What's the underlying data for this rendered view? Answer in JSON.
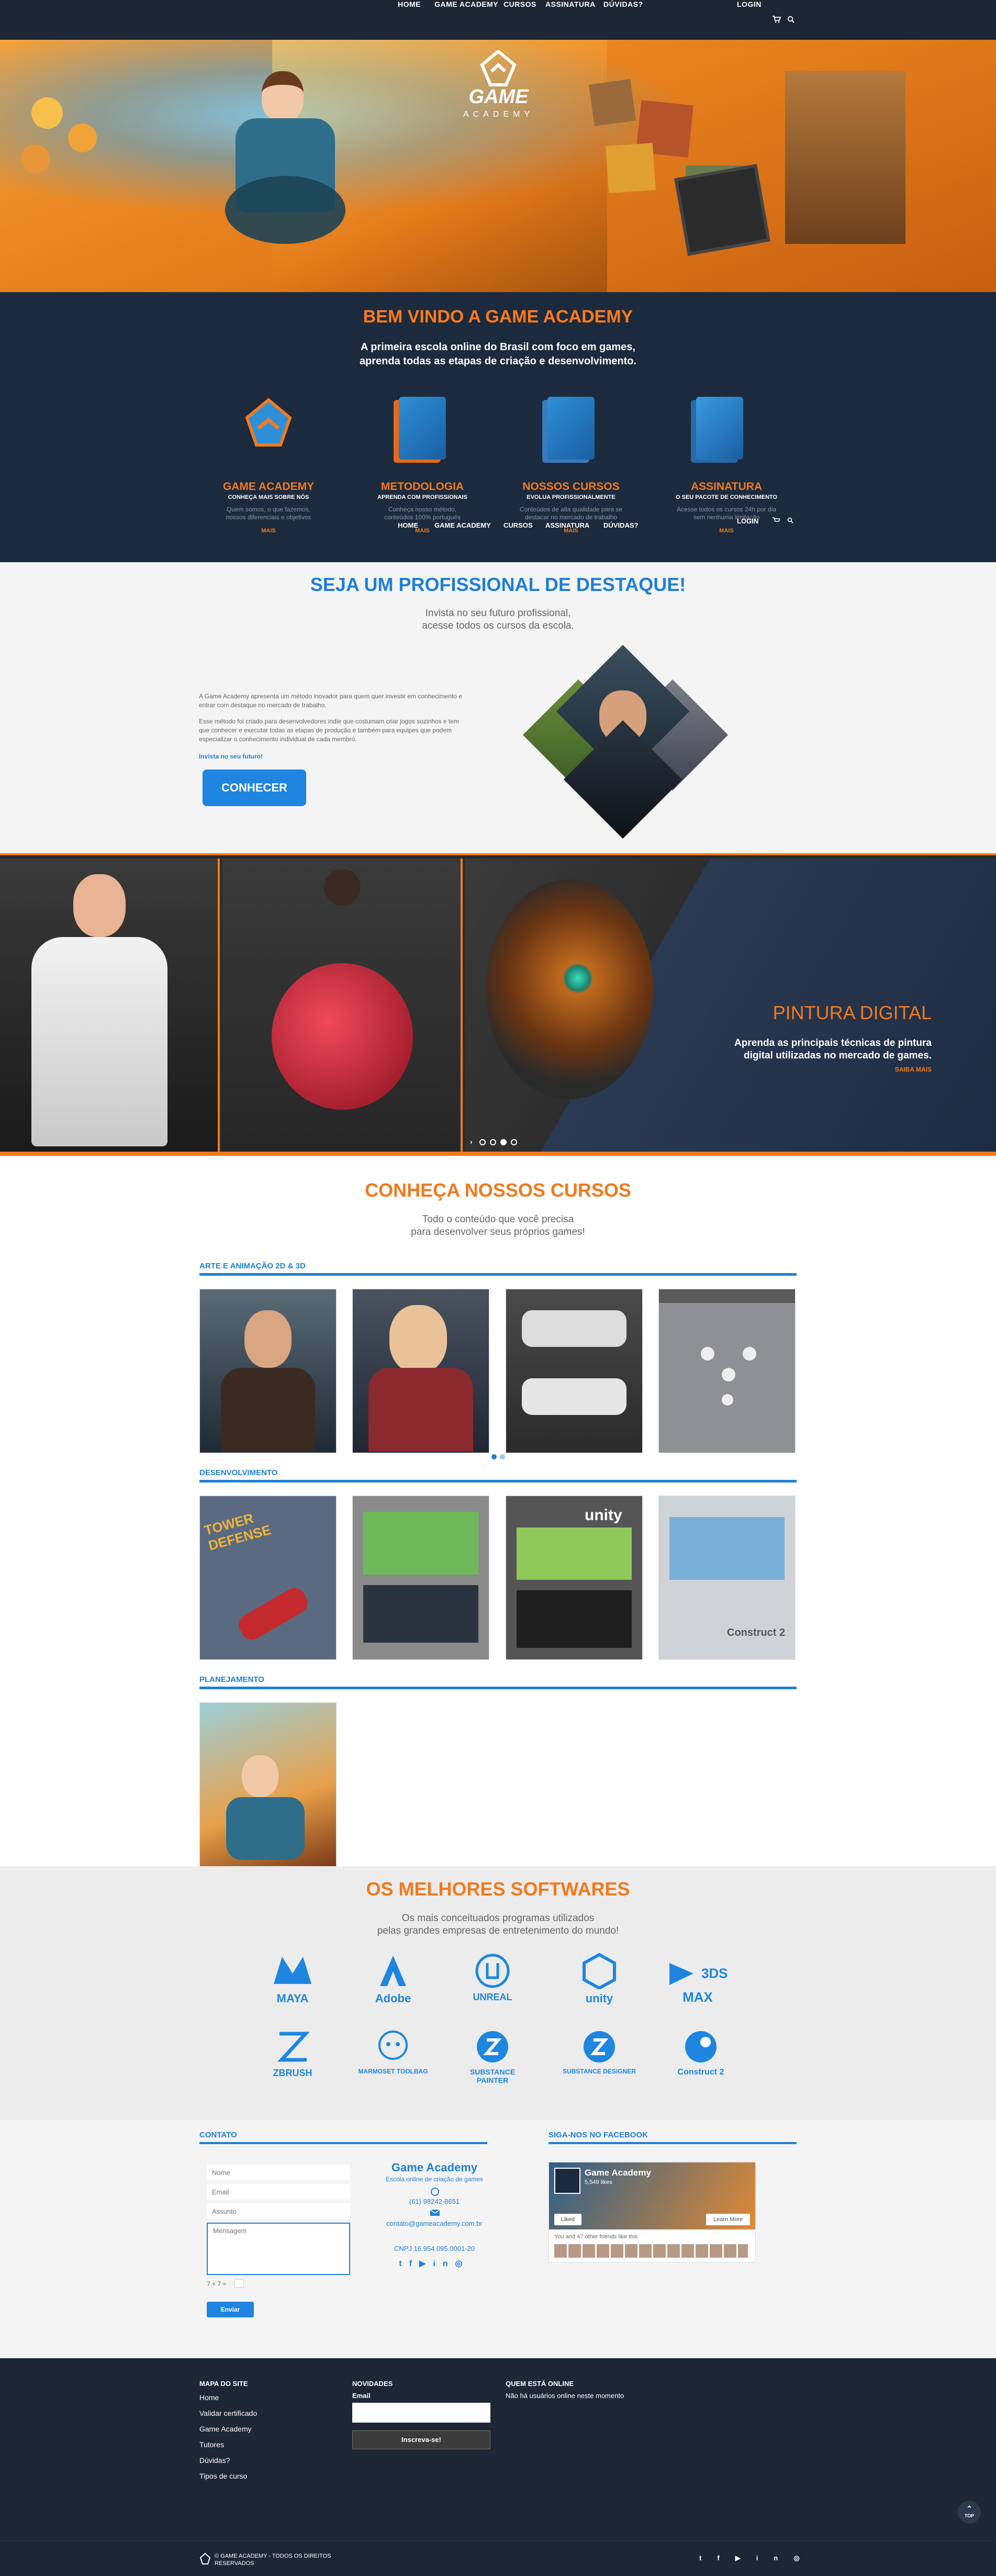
{
  "nav": {
    "items": [
      "HOME",
      "GAME ACADEMY",
      "CURSOS",
      "ASSINATURA",
      "DÚVIDAS?"
    ],
    "login": "LOGIN"
  },
  "hero": {
    "logo_word": "GAME",
    "logo_sub": "ACADEMY"
  },
  "welcome": {
    "title": "BEM VINDO A GAME ACADEMY",
    "line1": "A primeira escola online do Brasil com foco em games,",
    "line2": "aprenda todas as etapas de criação e desenvolvimento.",
    "features": [
      {
        "title": "GAME ACADEMY",
        "sub": "CONHEÇA MAIS SOBRE NÓS",
        "text1": "Quem somos, o que fazemos,",
        "text2": "nossos diferenciais e objetivos",
        "more": "MAIS"
      },
      {
        "title": "METODOLOGIA",
        "sub": "APRENDA COM PROFISSIONAIS",
        "text1": "Conheça nosso método,",
        "text2": "conteúdos 100% português",
        "more": "MAIS"
      },
      {
        "title": "NOSSOS CURSOS",
        "sub": "EVOLUA PROFISSIONALMENTE",
        "text1": "Conteúdos de alta qualidade para se",
        "text2": "destacar no mercado de trabalho",
        "more": "MAIS"
      },
      {
        "title": "ASSINATURA",
        "sub": "O SEU PACOTE DE CONHECIMENTO",
        "text1": "Acesse todos os cursos 24h por dia",
        "text2": "sem nenhuma limitação",
        "more": "MAIS"
      }
    ]
  },
  "pro": {
    "title": "SEJA UM PROFISSIONAL DE DESTAQUE!",
    "line1": "Invista no seu futuro profissional,",
    "line2": "acesse todos os cursos da escola.",
    "p1": "A Game Academy apresenta um método inovador para quem quer investir em conhecimento e entrar com destaque no mercado de trabalho.",
    "p2": "Esse método foi criado para desenvolvedores indie que costumam criar jogos sozinhos e tem que conhecer e executar todas as etapas de produção e também para equipes que podem especializar o conhecimento individual de cada membro.",
    "link": "Invista no seu futuro!",
    "button": "CONHECER"
  },
  "slider": {
    "title": "PINTURA DIGITAL",
    "line1": "Aprenda as principais técnicas de pintura",
    "line2": "digital utilizadas no mercado de games.",
    "more": "SAIBA MAIS"
  },
  "courses": {
    "title": "CONHEÇA NOSSOS CURSOS",
    "line1": "Todo o conteúdo que você precisa",
    "line2": "para desenvolver seus próprios games!",
    "categories": [
      "ARTE E ANIMAÇÃO 2D & 3D",
      "DESENVOLVIMENTO",
      "PLANEJAMENTO"
    ],
    "dev_labels": [
      "TOWER DEFENSE",
      "unity",
      "Construct 2"
    ]
  },
  "softwares": {
    "title": "OS MELHORES SOFTWARES",
    "line1": "Os mais conceituados programas utilizados",
    "line2": "pelas grandes empresas de entretenimento do mundo!",
    "logos": [
      "MAYA",
      "Adobe",
      "UNREAL",
      "unity",
      "3DS MAX",
      "ZBRUSH",
      "MARMOSET TOOLBAG",
      "SUBSTANCE PAINTER",
      "SUBSTANCE DESIGNER",
      "Construct 2"
    ]
  },
  "contact": {
    "heading": "CONTATO",
    "name_ph": "Nome",
    "email_ph": "Email",
    "subject_ph": "Assunto",
    "message_ph": "Mensagem",
    "captcha": "7 + 7 =",
    "send": "Enviar",
    "company": "Game Academy",
    "tagline": "Escola online de criação de games",
    "phone": "(61) 98242-8651",
    "email": "contato@gameacademy.com.br",
    "cnpj": "CNPJ 16.954.095.0001-20"
  },
  "facebook": {
    "heading": "SIGA-NOS NO FACEBOOK",
    "page": "Game Academy",
    "likes": "5,549 likes",
    "liked": "Liked",
    "learn": "Learn More",
    "friends": "You and 47 other friends like this"
  },
  "footer": {
    "sitemap_head": "MAPA DO SITE",
    "sitemap": [
      "Home",
      "Validar certificado",
      "Game Academy",
      "Tutores",
      "Dúvidas?",
      "Tipos de curso"
    ],
    "news_head": "NOVIDADES",
    "news_email": "Email",
    "news_button": "Inscreva-se!",
    "online_head": "QUEM ESTÁ ONLINE",
    "online_text": "Não há usuários online neste momento",
    "copyright1": "© GAME ACADEMY - TODOS OS DIREITOS",
    "copyright2": "RESERVADOS",
    "top": "TOP"
  }
}
